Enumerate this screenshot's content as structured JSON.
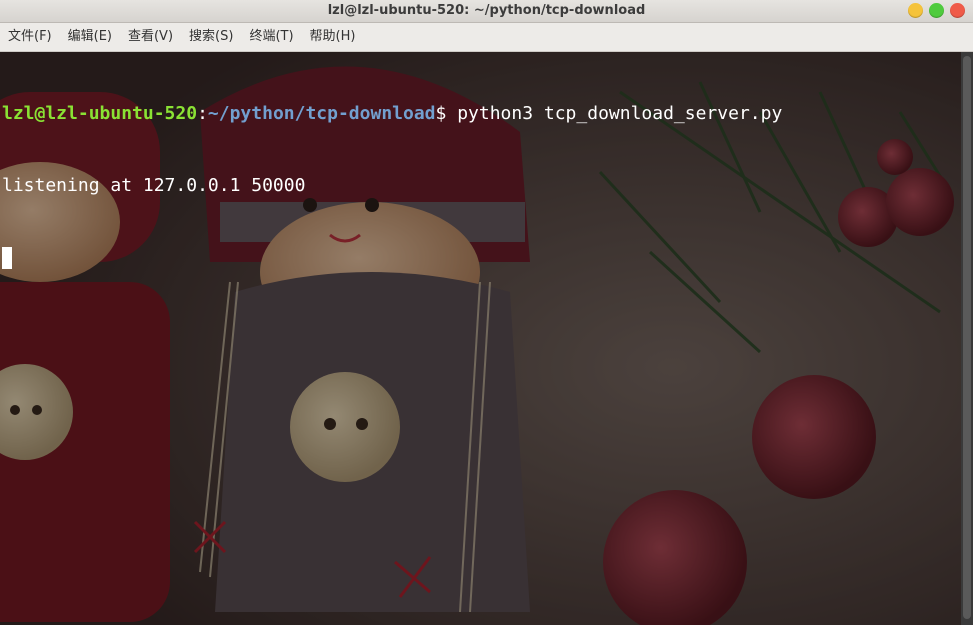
{
  "window": {
    "title": "lzl@lzl-ubuntu-520: ~/python/tcp-download"
  },
  "menu": [
    {
      "label": "文件(F)"
    },
    {
      "label": "编辑(E)"
    },
    {
      "label": "查看(V)"
    },
    {
      "label": "搜索(S)"
    },
    {
      "label": "终端(T)"
    },
    {
      "label": "帮助(H)"
    }
  ],
  "terminal": {
    "prompt_user": "lzl@lzl-ubuntu-520",
    "prompt_sep": ":",
    "prompt_path": "~/python/tcp-download",
    "prompt_symbol": "$ ",
    "command": "python3 tcp_download_server.py",
    "output": "listening at 127.0.0.1 50000"
  },
  "colors": {
    "user": "#8ae234",
    "path": "#729fcf",
    "text": "#ffffff"
  }
}
